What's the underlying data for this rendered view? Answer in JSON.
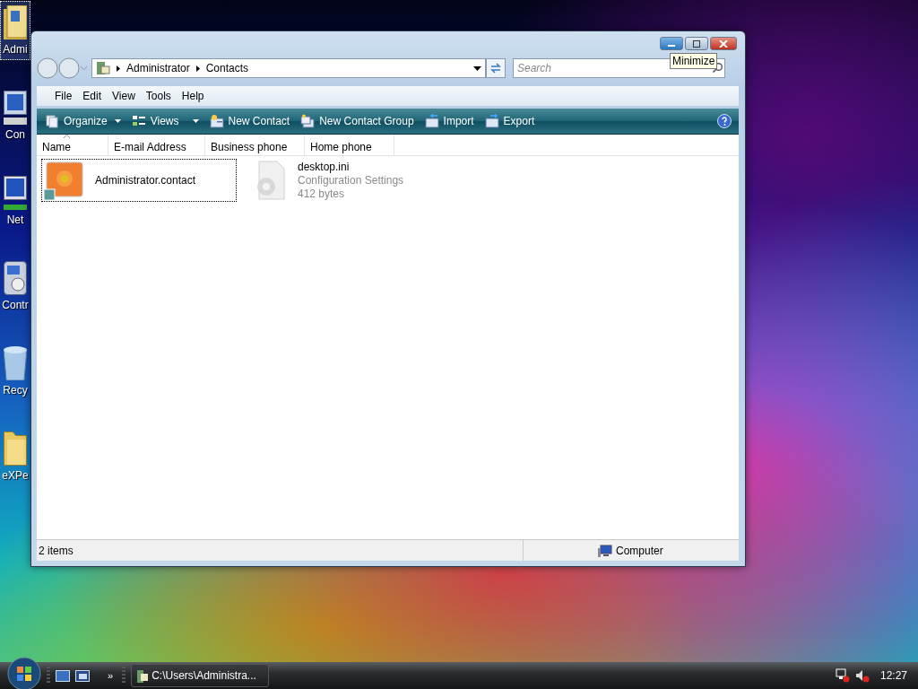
{
  "desktop_icons": [
    {
      "kind": "user-folder",
      "label": "Admi",
      "selected": true
    },
    {
      "kind": "computer",
      "label": "Con",
      "selected": false
    },
    {
      "kind": "network",
      "label": "Net",
      "selected": false
    },
    {
      "kind": "control-panel",
      "label": "Contr",
      "selected": false
    },
    {
      "kind": "recycle-bin",
      "label": "Recy",
      "selected": false
    },
    {
      "kind": "folder",
      "label": "eXPe",
      "selected": false
    }
  ],
  "window": {
    "breadcrumb": [
      "Administrator",
      "Contacts"
    ],
    "search": {
      "placeholder": "Search"
    },
    "tooltip": "Minimize",
    "menu": [
      "File",
      "Edit",
      "View",
      "Tools",
      "Help"
    ],
    "commands": [
      {
        "kind": "organize",
        "label": "Organize",
        "dropdown": true
      },
      {
        "kind": "views",
        "label": "Views",
        "dropdown": true
      },
      {
        "kind": "new-contact",
        "label": "New Contact",
        "dropdown": false
      },
      {
        "kind": "new-group",
        "label": "New Contact Group",
        "dropdown": false
      },
      {
        "kind": "import",
        "label": "Import",
        "dropdown": false
      },
      {
        "kind": "export",
        "label": "Export",
        "dropdown": false
      }
    ],
    "columns": [
      {
        "label": "Name",
        "sorted": true
      },
      {
        "label": "E-mail Address",
        "sorted": false
      },
      {
        "label": "Business phone",
        "sorted": false
      },
      {
        "label": "Home phone",
        "sorted": false
      }
    ],
    "items": [
      {
        "kind": "contact",
        "name": "Administrator.contact",
        "selected": true
      },
      {
        "kind": "settings-file",
        "name": "desktop.ini",
        "type": "Configuration Settings",
        "size": "412 bytes",
        "selected": false
      }
    ],
    "status_bar": {
      "count": "2 items",
      "location": "Computer"
    }
  },
  "taskbar": {
    "overflow": "»",
    "task": "C:\\Users\\Administra...",
    "clock": "12:27"
  }
}
